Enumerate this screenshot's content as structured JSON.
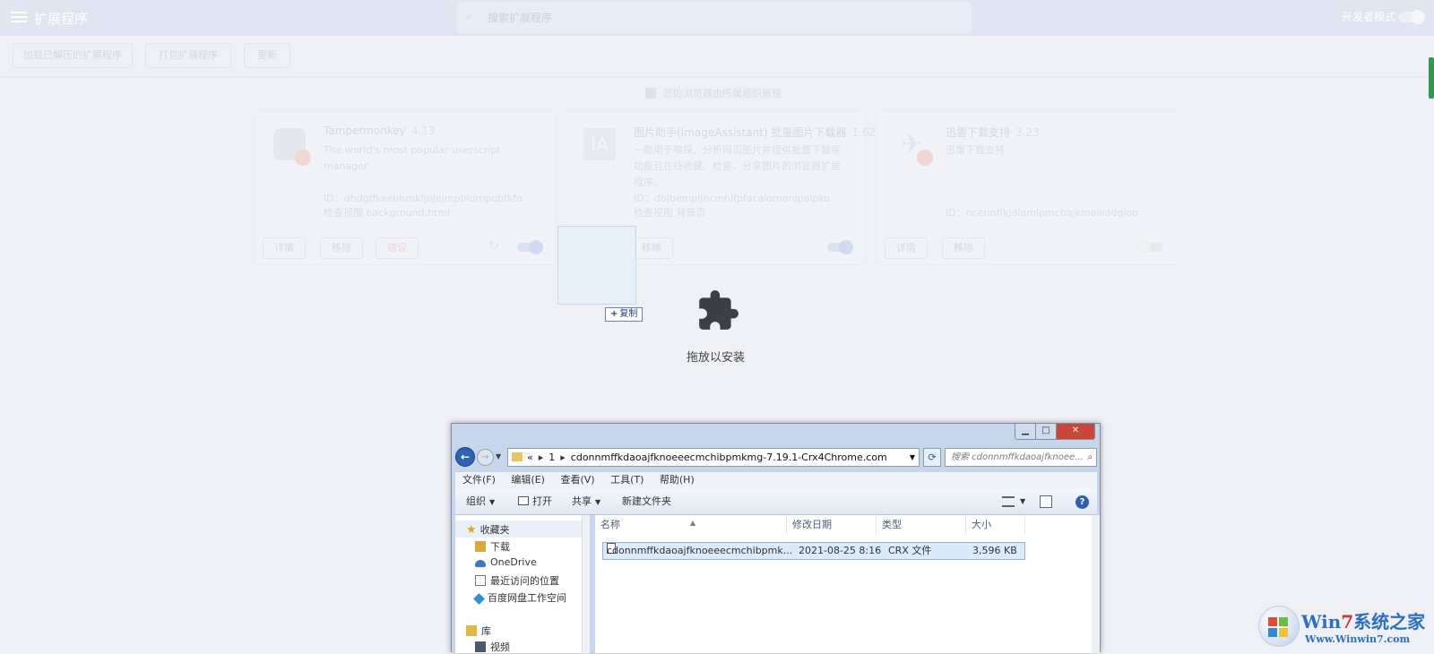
{
  "topbar": {
    "title": "扩展程序",
    "search_placeholder": "搜索扩展程序",
    "devmode_label": "开发者模式"
  },
  "actions": {
    "load_unpacked": "加载已解压的扩展程序",
    "pack": "打包扩展程序",
    "update": "更新"
  },
  "promo": "您的浏览器由所属组织管理",
  "cards": [
    {
      "name": "Tampermonkey",
      "version": "4.13",
      "desc": "The world's most popular userscript manager",
      "id": "ID：dhdgffkkebhmkfjojejmpbldmpobfkfo",
      "view": "检查视图 background.html",
      "details": "详情",
      "remove": "移除",
      "error": "错误"
    },
    {
      "name": "图片助手(ImageAssistant) 批量图片下载器",
      "version": "1.62",
      "desc": "一款用于嗅探、分析网页图片并提供批量下载等功能且在线收藏、检索、分享图片的浏览器扩展程序。",
      "id": "ID：dbjbempljhcmhlfpfacalomonjpalpko",
      "view": "检查视图 背景页",
      "details": "详情",
      "remove": "移除"
    },
    {
      "name": "迅雷下载支持",
      "version": "3.23",
      "desc": "迅雷下载支持",
      "id": "ID：ncennffkjdiamlpmcbajkmaiiiddgioo",
      "details": "详情",
      "remove": "移除"
    }
  ],
  "drop": {
    "copy_label": "复制",
    "label": "拖放以安装"
  },
  "explorer": {
    "address_prefix": "«",
    "address_seg1": "1",
    "address_folder": "cdonnmffkdaoajfknoeeecmchibpmkmg-7.19.1-Crx4Chrome.com",
    "search_placeholder": "搜索 cdonnmffkdaoajfknoee...",
    "menu": [
      "文件(F)",
      "编辑(E)",
      "查看(V)",
      "工具(T)",
      "帮助(H)"
    ],
    "toolbar": {
      "organize": "组织",
      "open": "打开",
      "share": "共享",
      "new_folder": "新建文件夹"
    },
    "nav": {
      "favorites": "收藏夹",
      "downloads": "下载",
      "onedrive": "OneDrive",
      "recent": "最近访问的位置",
      "baidu": "百度网盘工作空间",
      "libraries": "库",
      "videos": "视频"
    },
    "columns": {
      "name": "名称",
      "date": "修改日期",
      "type": "类型",
      "size": "大小"
    },
    "file": {
      "name": "cdonnmffkdaoajfknoeeecmchibpmk...",
      "date": "2021-08-25 8:16",
      "type": "CRX 文件",
      "size": "3,596 KB"
    }
  },
  "watermark": {
    "title_a": "Win",
    "title_b": "7",
    "title_c": "系统之家",
    "url": "Www.Winwin7.com"
  }
}
